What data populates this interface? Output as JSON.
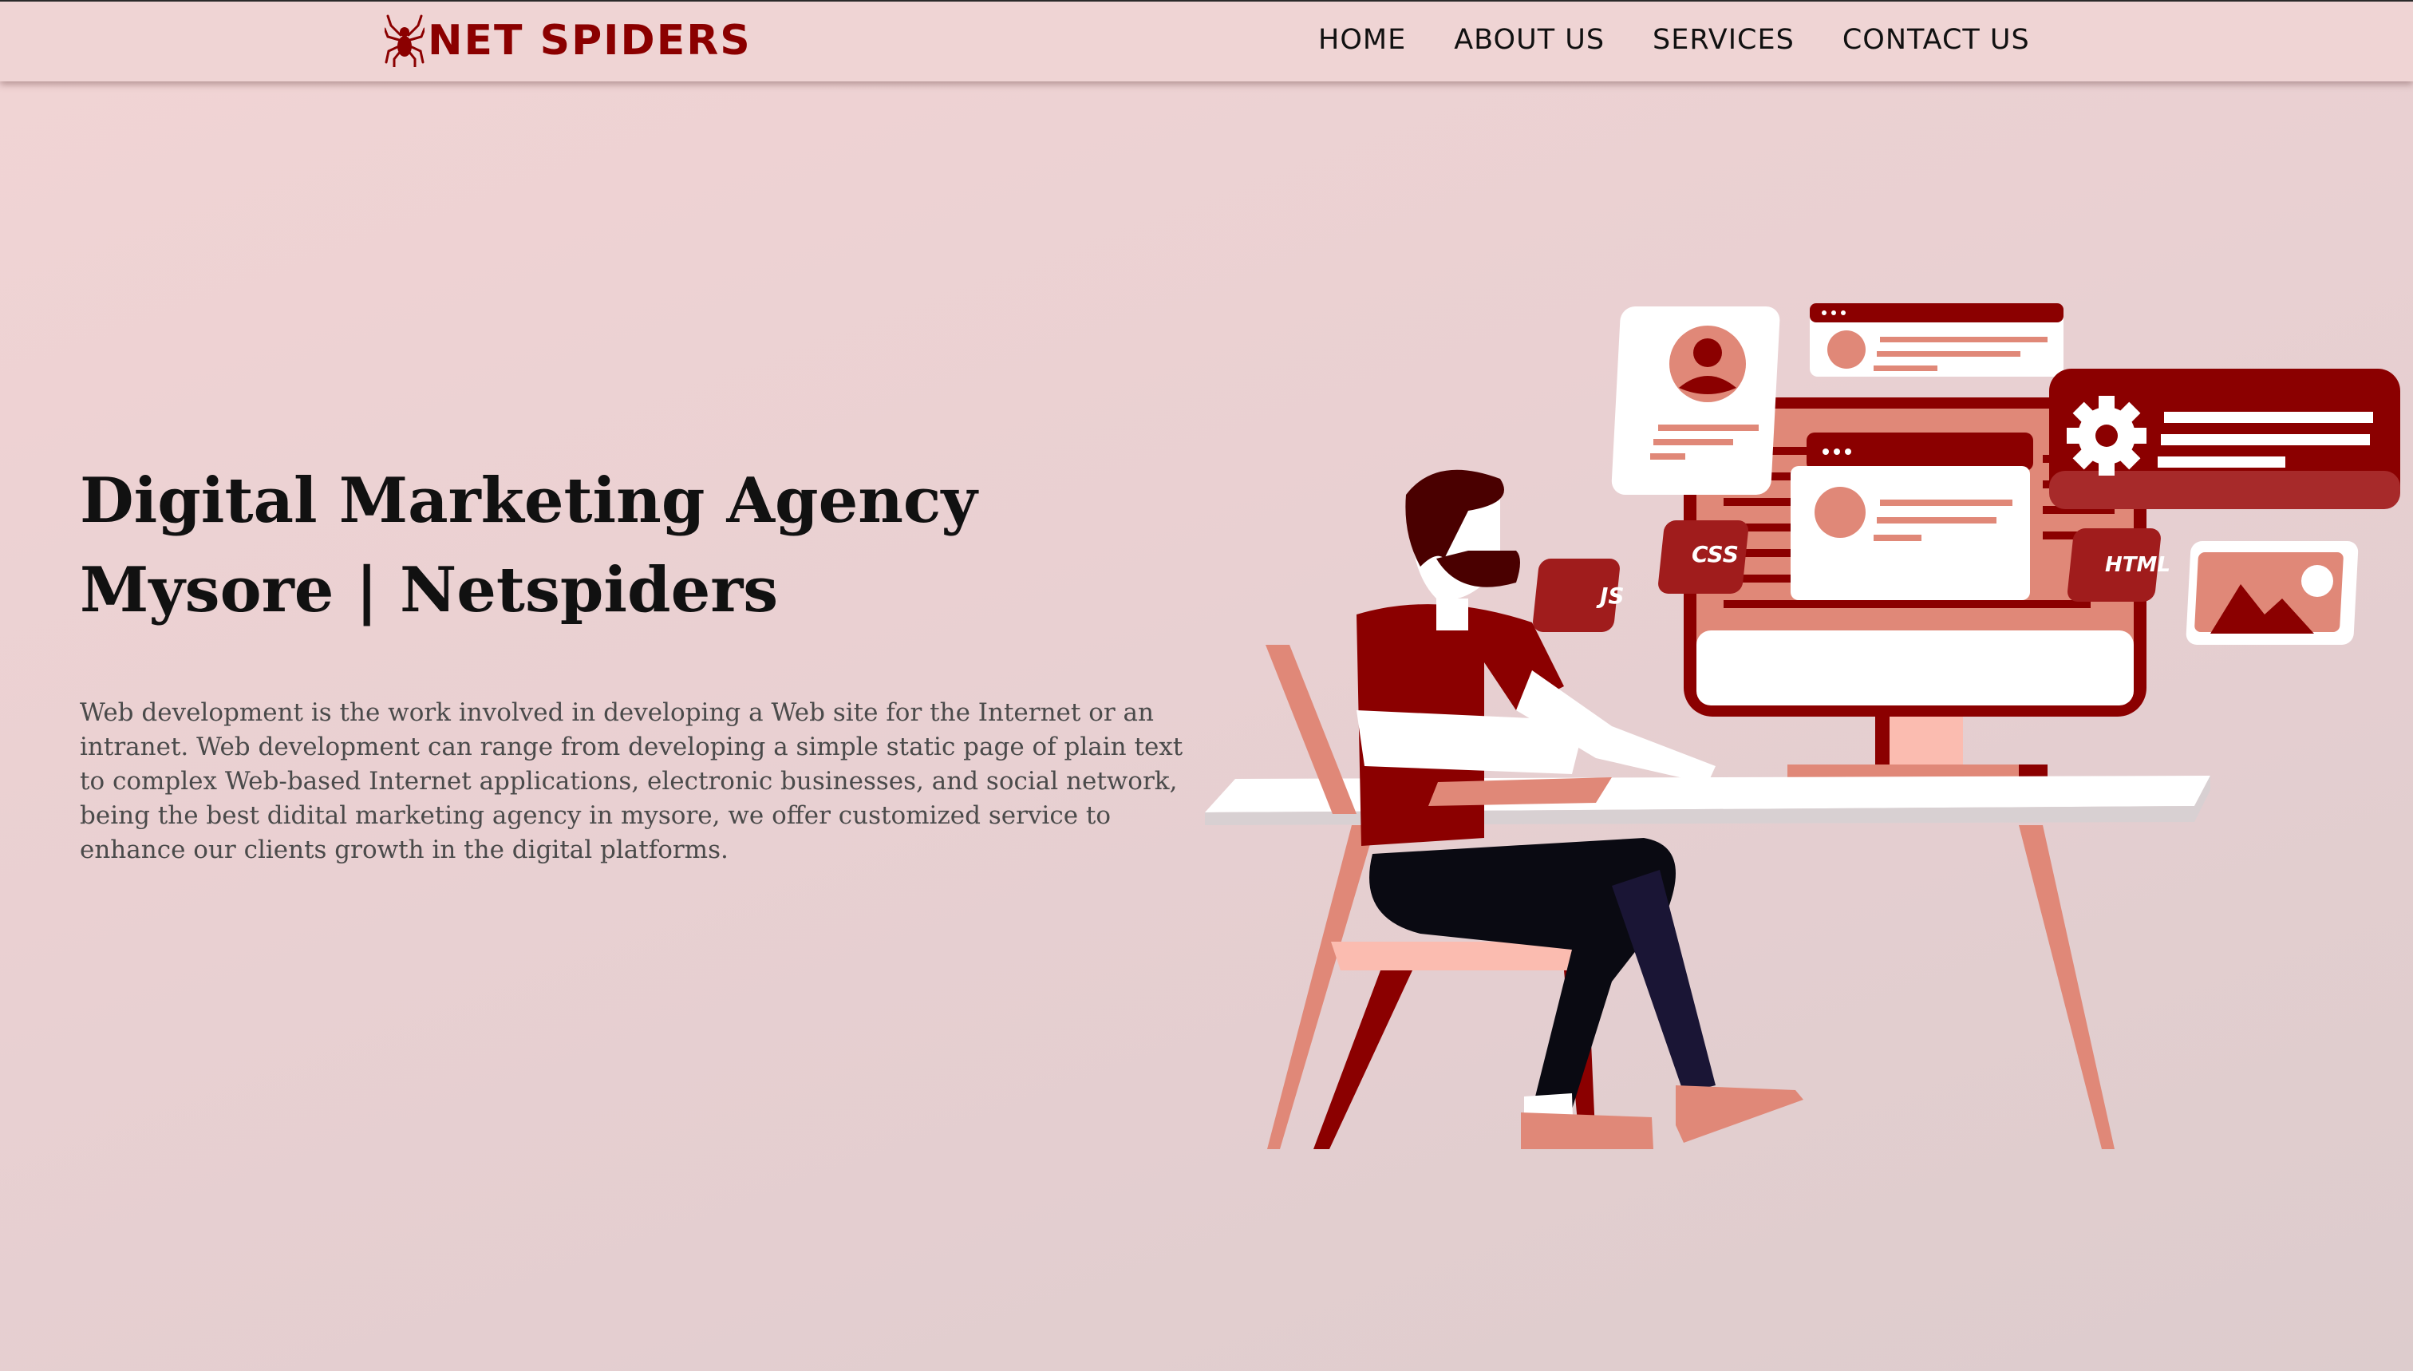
{
  "brand": {
    "name": "NET SPIDERS",
    "logo_icon": "spider-icon",
    "color": "#8b0000"
  },
  "nav": {
    "items": [
      {
        "label": "HOME"
      },
      {
        "label": "ABOUT US"
      },
      {
        "label": "SERVICES"
      },
      {
        "label": "CONTACT US"
      }
    ]
  },
  "hero": {
    "title": "Digital Marketing Agency Mysore | Netspiders",
    "description": "Web development is the work involved in developing a Web site for the Internet or an intranet. Web development can range from developing a simple static page of plain text to complex Web-based Internet applications, electronic businesses, and social network, being the best didital marketing agency in mysore, we offer customized service to enhance our clients growth in the digital platforms."
  },
  "illustration": {
    "badges": {
      "js": "JS",
      "css": "CSS",
      "html": "HTML"
    },
    "accent": "#8b0000",
    "secondary": "#e08878"
  }
}
